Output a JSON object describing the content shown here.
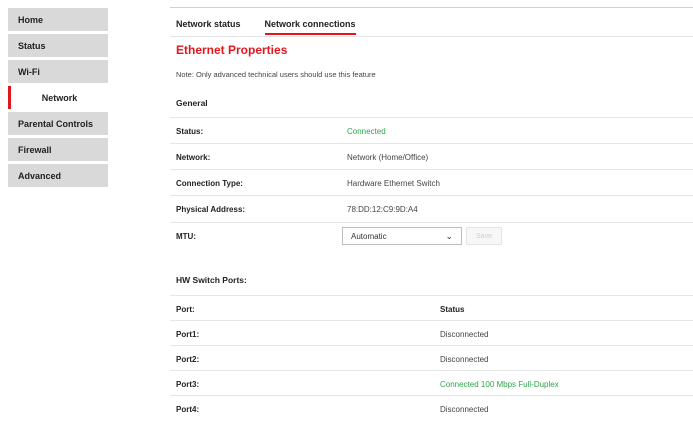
{
  "sidebar": {
    "items": [
      {
        "label": "Home"
      },
      {
        "label": "Status"
      },
      {
        "label": "Wi-Fi"
      },
      {
        "label": "Network",
        "active": true
      },
      {
        "label": "Parental Controls"
      },
      {
        "label": "Firewall"
      },
      {
        "label": "Advanced"
      }
    ]
  },
  "tabs": [
    {
      "label": "Network status"
    },
    {
      "label": "Network connections",
      "active": true
    }
  ],
  "page": {
    "title": "Ethernet Properties",
    "note": "Note: Only advanced technical users should use this feature"
  },
  "general": {
    "heading": "General",
    "status": {
      "label": "Status:",
      "value": "Connected"
    },
    "network": {
      "label": "Network:",
      "value": "Network (Home/Office)"
    },
    "connection_type": {
      "label": "Connection Type:",
      "value": "Hardware Ethernet Switch"
    },
    "physical_address": {
      "label": "Physical Address:",
      "value": "78:DD:12:C9:9D:A4"
    },
    "mtu": {
      "label": "MTU:",
      "selected": "Automatic",
      "save_label": "Save"
    }
  },
  "hw_ports": {
    "heading": "HW Switch Ports:",
    "columns": [
      "Port:",
      "Status"
    ],
    "rows": [
      {
        "port": "Port1:",
        "status": "Disconnected"
      },
      {
        "port": "Port2:",
        "status": "Disconnected"
      },
      {
        "port": "Port3:",
        "status": "Connected 100 Mbps Full-Duplex"
      },
      {
        "port": "Port4:",
        "status": "Disconnected"
      }
    ]
  },
  "colors": {
    "accent": "#e0181e",
    "connected": "#2ea64a",
    "sidebar_bg": "#d9d9d9"
  }
}
